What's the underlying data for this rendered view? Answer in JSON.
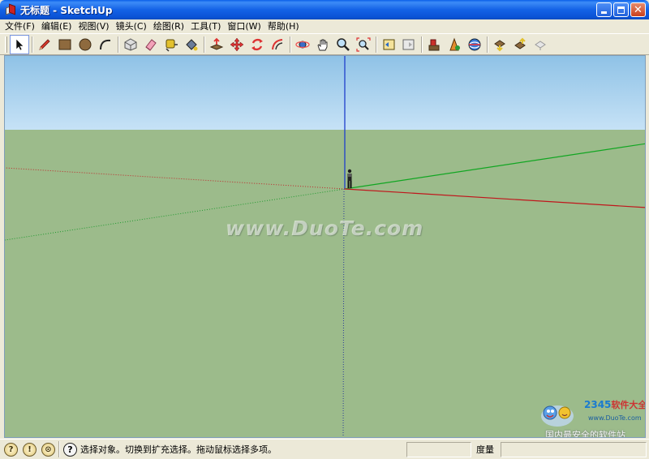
{
  "window": {
    "title": "无标题 - SketchUp",
    "accent_color": "#0A53D6"
  },
  "menu": [
    {
      "label": "文件(F)"
    },
    {
      "label": "编辑(E)"
    },
    {
      "label": "视图(V)"
    },
    {
      "label": "镜头(C)"
    },
    {
      "label": "绘图(R)"
    },
    {
      "label": "工具(T)"
    },
    {
      "label": "窗口(W)"
    },
    {
      "label": "帮助(H)"
    }
  ],
  "toolbar": {
    "groups": [
      [
        "select-icon"
      ],
      [
        "pencil-icon",
        "rectangle-icon",
        "circle-icon",
        "arc-icon"
      ],
      [
        "make-component-icon",
        "eraser-icon",
        "tape-measure-icon",
        "paint-bucket-icon"
      ],
      [
        "push-pull-icon",
        "move-icon",
        "rotate-icon",
        "offset-icon"
      ],
      [
        "orbit-icon",
        "pan-icon",
        "zoom-icon",
        "zoom-extents-icon"
      ],
      [
        "previous-view-icon",
        "next-view-icon"
      ],
      [
        "add-location-icon",
        "place-model-icon",
        "get-models-icon"
      ],
      [
        "share-model-icon",
        "get-components-icon",
        "share-component-icon"
      ]
    ],
    "active_tool": "select-icon"
  },
  "viewport": {
    "sky_color": "#BEDDF3",
    "ground_color": "#9CBB8B",
    "watermark": "www.DuoTe.com"
  },
  "badge": {
    "brand": "2345",
    "brand_suffix": "软件大全",
    "url": "www.DuoTe.com",
    "slogan": "国内最安全的软件站"
  },
  "statusbar": {
    "text": "选择对象。切换到扩充选择。拖动鼠标选择多项。",
    "measure_label": "度量",
    "measure_value": ""
  }
}
